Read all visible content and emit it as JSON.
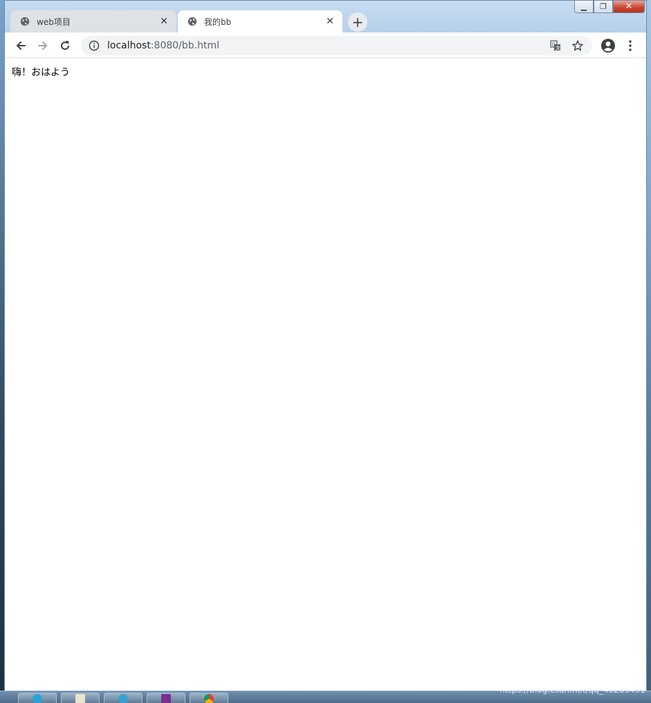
{
  "browser": {
    "tabs": [
      {
        "title": "web项目",
        "active": false
      },
      {
        "title": "我的bb",
        "active": true
      }
    ],
    "new_tab_label": "+",
    "address": {
      "host": "localhost",
      "path": ":8080/bb.html"
    }
  },
  "page": {
    "text": "嗨！おはよう"
  },
  "watermark": "https://blog.csdn.net/qq_40283491",
  "colors": {
    "tab_active": "#ffffff",
    "tab_strip": "#dee1e6",
    "omnibox": "#f1f3f4",
    "close_button": "#c7432c"
  },
  "icons": {
    "tab_favicon": "globe-icon",
    "back": "arrow-left-icon",
    "forward": "arrow-right-icon",
    "reload": "reload-icon",
    "site_info": "info-icon",
    "translate": "translate-icon",
    "bookmark": "star-icon",
    "profile": "account-icon",
    "menu": "kebab-menu-icon"
  }
}
